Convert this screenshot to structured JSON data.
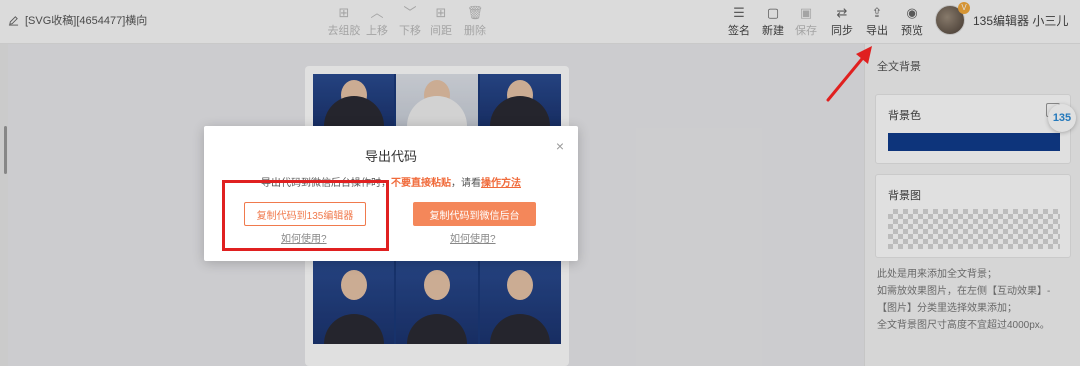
{
  "doc": {
    "title": "[SVG收稿][4654477]横向"
  },
  "toolbar_center": [
    {
      "label": "去组胶",
      "icon": "⊞"
    },
    {
      "label": "上移",
      "icon": "︿"
    },
    {
      "label": "下移",
      "icon": "﹀"
    },
    {
      "label": "间距",
      "icon": "⊞"
    },
    {
      "label": "删除",
      "icon": "🗑"
    }
  ],
  "toolbar_right": [
    {
      "label": "签名",
      "icon": "☰"
    },
    {
      "label": "新建",
      "icon": "▢"
    },
    {
      "label": "保存",
      "icon": "▣"
    },
    {
      "label": "同步",
      "icon": "⇄"
    },
    {
      "label": "导出",
      "icon": "⇪"
    },
    {
      "label": "预览",
      "icon": "◉"
    }
  ],
  "user": {
    "name": "135编辑器 小三儿",
    "vip_badge": "V"
  },
  "right_panel": {
    "title": "全文背景",
    "bg_color_label": "背景色",
    "bg_color": "#0f3c8c",
    "bg_image_label": "背景图",
    "note_lines": [
      "此处是用来添加全文背景；",
      "如需放效果图片，在左侧【互动效果】-",
      "【图片】分类里选择效果添加；",
      "全文背景图尺寸高度不宜超过4000px。"
    ],
    "badge": "135"
  },
  "modal": {
    "title": "导出代码",
    "close": "×",
    "desc_prefix": "导出代码到微信后台操作时，",
    "desc_warning": "不要直接粘贴",
    "desc_mid": "，请看",
    "desc_link": "操作方法",
    "btn_copy_135": "复制代码到135编辑器",
    "btn_copy_wechat": "复制代码到微信后台",
    "howto_1": "如何使用?",
    "howto_2": "如何使用?"
  }
}
